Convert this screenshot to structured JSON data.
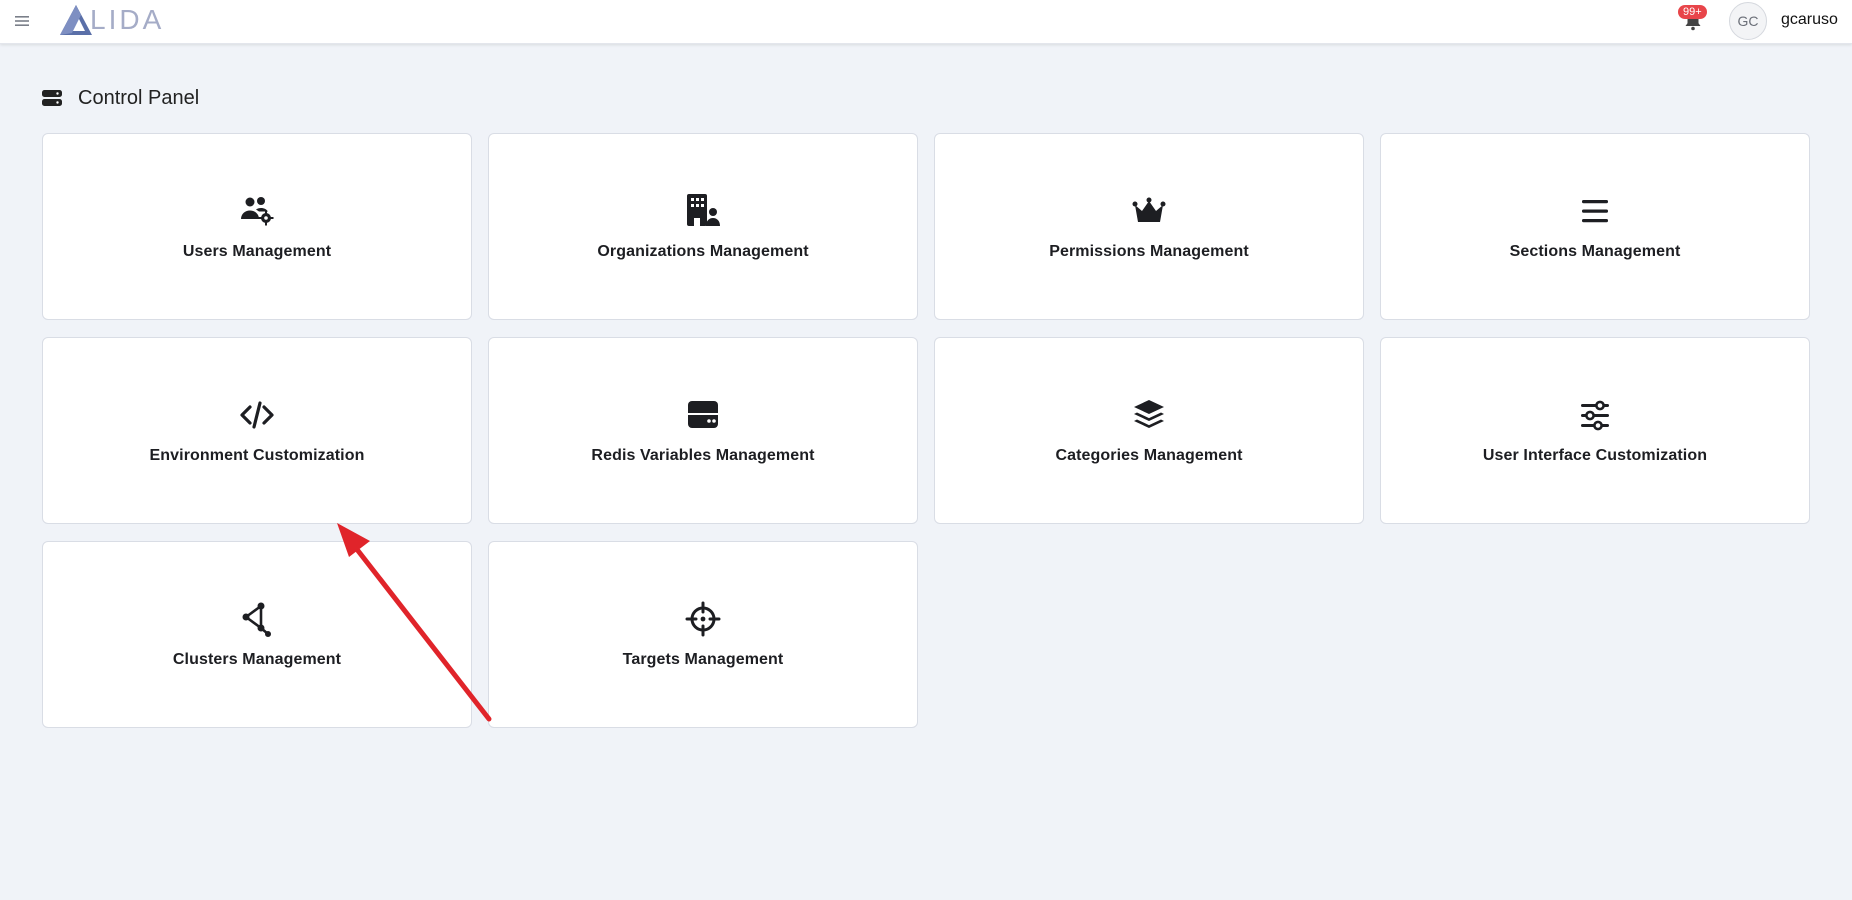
{
  "header": {
    "logo_text": "LIDA",
    "notification_badge": "99+",
    "avatar_initials": "GC",
    "username": "gcaruso"
  },
  "page": {
    "title": "Control Panel"
  },
  "cards": [
    {
      "label": "Users Management",
      "icon": "users-gear-icon"
    },
    {
      "label": "Organizations Management",
      "icon": "building-user-icon"
    },
    {
      "label": "Permissions Management",
      "icon": "crown-icon"
    },
    {
      "label": "Sections Management",
      "icon": "bars-icon"
    },
    {
      "label": "Environment Customization",
      "icon": "code-icon"
    },
    {
      "label": "Redis Variables Management",
      "icon": "server-icon"
    },
    {
      "label": "Categories Management",
      "icon": "layers-icon"
    },
    {
      "label": "User Interface Customization",
      "icon": "sliders-icon"
    },
    {
      "label": "Clusters Management",
      "icon": "cluster-icon"
    },
    {
      "label": "Targets Management",
      "icon": "crosshairs-icon"
    }
  ],
  "colors": {
    "accent_logo": "#5a6fa8",
    "badge": "#e8454a",
    "annotation_arrow": "#e0242a"
  }
}
